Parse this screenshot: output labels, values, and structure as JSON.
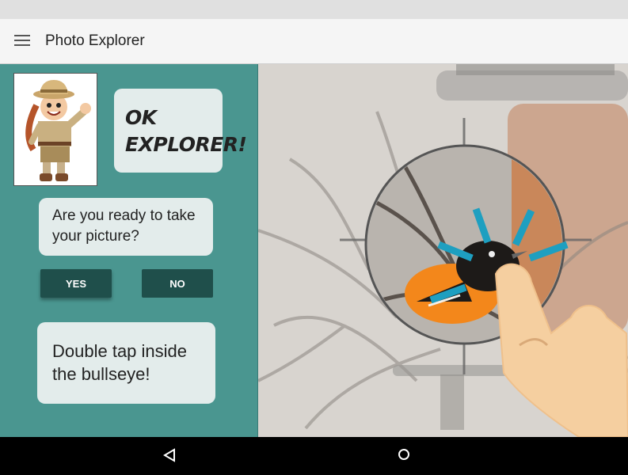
{
  "app": {
    "title": "Photo Explorer"
  },
  "panel": {
    "ok_bubble": {
      "line1": "OK",
      "line2": "EXPLORER!"
    },
    "question": "Are you ready to take your picture?",
    "yes_label": "YES",
    "no_label": "NO",
    "tip": "Double tap inside the bullseye!"
  },
  "icons": {
    "menu": "menu-icon",
    "back": "back-triangle-icon",
    "home": "home-circle-icon",
    "hand": "pointing-hand-icon"
  },
  "colors": {
    "panel": "#4a9690",
    "button": "#1f4f4b",
    "bubble": "#e3eceb",
    "tap_rays": "#1e9fc0",
    "hand": "#f5cfa0"
  }
}
